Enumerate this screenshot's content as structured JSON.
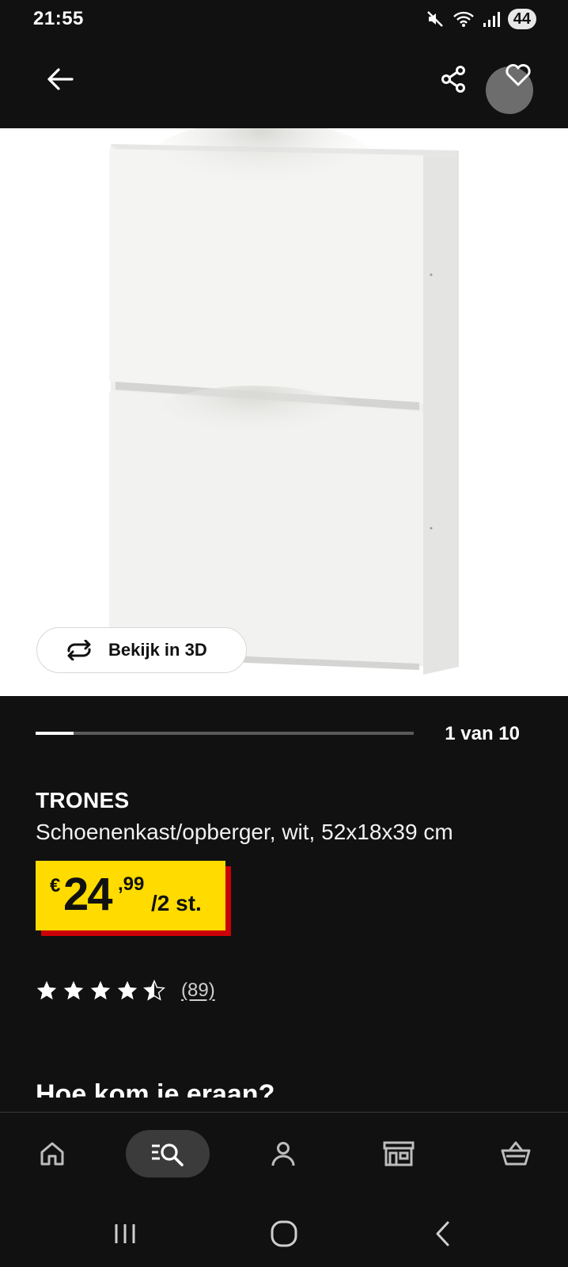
{
  "status_bar": {
    "time": "21:55",
    "battery": "44",
    "icons": [
      "mute-icon",
      "wifi-icon",
      "signal-icon",
      "battery-icon"
    ]
  },
  "top_bar": {
    "icons": [
      "back-arrow-icon",
      "share-icon",
      "heart-icon"
    ]
  },
  "gallery": {
    "view_3d_label": "Bekijk in 3D",
    "counter": "1 van 10",
    "current_index": 1,
    "total": 10
  },
  "product": {
    "name": "TRONES",
    "description": "Schoenenkast/opberger, wit, 52x18x39 cm",
    "price": {
      "currency": "€",
      "integer": "24",
      "decimal": ",99",
      "unit": "/2 st."
    },
    "rating": {
      "value": 4.5,
      "max": 5,
      "count_label": "(89)"
    }
  },
  "next_section_heading": "Hoe kom je eraan?",
  "bottom_nav": {
    "items": [
      "home-icon",
      "search-icon",
      "profile-icon",
      "store-icon",
      "cart-icon"
    ],
    "active": "search-icon"
  },
  "system_nav": {
    "icons": [
      "recent-apps-icon",
      "home-button-icon",
      "back-icon"
    ]
  },
  "colors": {
    "background": "#111111",
    "price_yellow": "#ffdb00",
    "price_red": "#cc0008",
    "image_background": "#ffffff"
  }
}
